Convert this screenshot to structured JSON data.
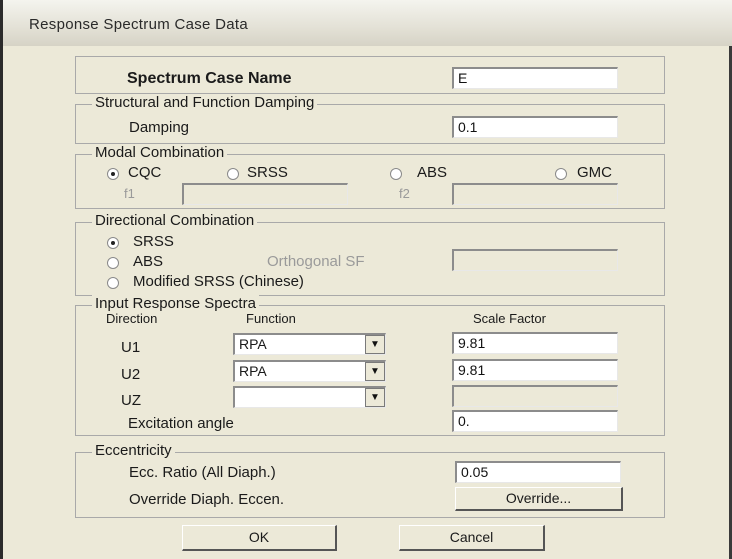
{
  "window": {
    "title": "Response Spectrum Case Data"
  },
  "case_name": {
    "label": "Spectrum Case Name",
    "value": "E"
  },
  "damping_group": {
    "title": "Structural and Function Damping",
    "label": "Damping",
    "value": "0.1"
  },
  "modal_group": {
    "title": "Modal Combination",
    "options": [
      "CQC",
      "SRSS",
      "ABS",
      "GMC"
    ],
    "selected": "CQC",
    "f1_label": "f1",
    "f1_value": "",
    "f2_label": "f2",
    "f2_value": ""
  },
  "directional_group": {
    "title": "Directional Combination",
    "options": [
      "SRSS",
      "ABS",
      "Modified SRSS (Chinese)"
    ],
    "selected": "SRSS",
    "orthogonal_label": "Orthogonal SF",
    "orthogonal_value": ""
  },
  "input_group": {
    "title": "Input Response Spectra",
    "col_direction": "Direction",
    "col_function": "Function",
    "col_scale": "Scale Factor",
    "rows": [
      {
        "direction": "U1",
        "function": "RPA",
        "scale": "9.81"
      },
      {
        "direction": "U2",
        "function": "RPA",
        "scale": "9.81"
      },
      {
        "direction": "UZ",
        "function": "",
        "scale": ""
      }
    ],
    "excitation_label": "Excitation angle",
    "excitation_value": "0."
  },
  "eccentricity_group": {
    "title": "Eccentricity",
    "ratio_label": "Ecc. Ratio (All Diaph.)",
    "ratio_value": "0.05",
    "override_label": "Override Diaph. Eccen.",
    "override_button": "Override..."
  },
  "buttons": {
    "ok": "OK",
    "cancel": "Cancel"
  }
}
